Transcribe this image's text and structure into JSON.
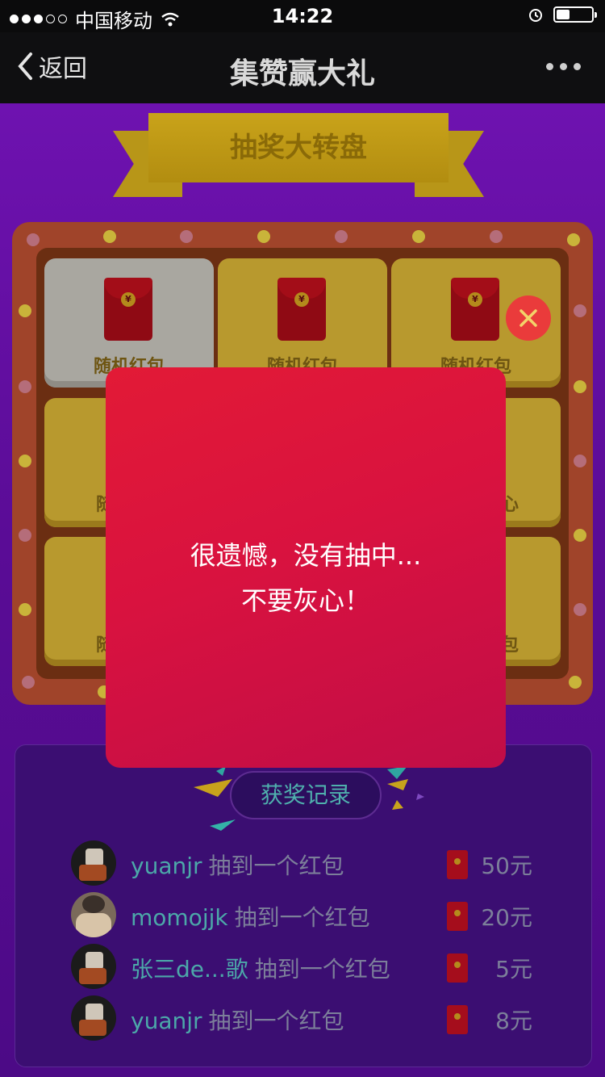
{
  "status_bar": {
    "carrier": "中国移动",
    "time": "14:22"
  },
  "nav": {
    "back_label": "返回",
    "title": "集赞赢大礼"
  },
  "banner": {
    "title": "抽奖大转盘"
  },
  "grid": {
    "cells": [
      {
        "label": "随机红包"
      },
      {
        "label": "随机红包"
      },
      {
        "label": "随机红包"
      },
      {
        "label": "随"
      },
      {
        "label": "心"
      },
      {
        "label": "随"
      },
      {
        "label": "包"
      }
    ],
    "coin_symbol": "¥"
  },
  "modal": {
    "line1": "很遗憾，没有抽中...",
    "line2": "不要灰心！"
  },
  "records": {
    "title": "获奖记录",
    "items": [
      {
        "user": "yuanjr",
        "action": "抽到一个红包",
        "amount": "50元"
      },
      {
        "user": "momojjk",
        "action": "抽到一个红包",
        "amount": "20元"
      },
      {
        "user": "张三de...歌",
        "action": "抽到一个红包",
        "amount": "5元"
      },
      {
        "user": "yuanjr",
        "action": "抽到一个红包",
        "amount": "8元"
      }
    ]
  }
}
